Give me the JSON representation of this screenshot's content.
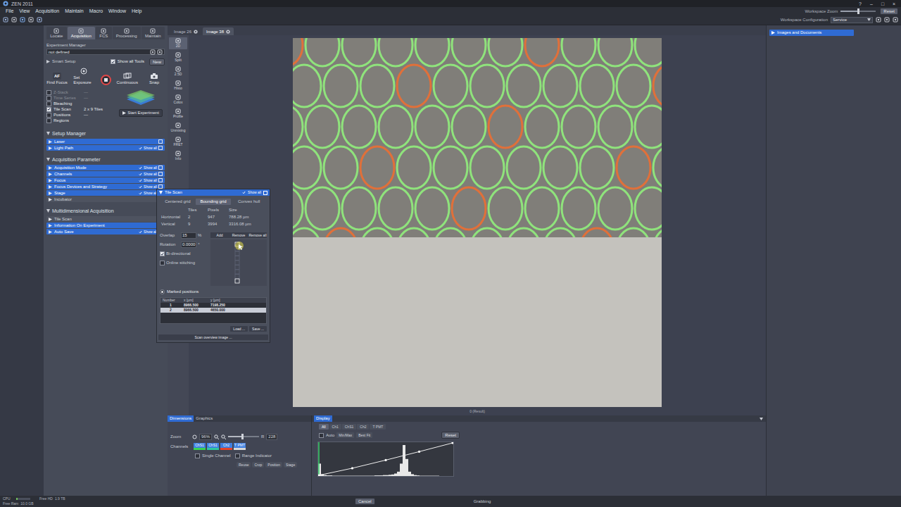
{
  "window": {
    "title": "ZEN 2011",
    "controls": [
      "?",
      "–",
      "□",
      "×"
    ]
  },
  "menu": [
    "File",
    "View",
    "Acquisition",
    "Maintain",
    "Macro",
    "Window",
    "Help"
  ],
  "workspace_zoom": {
    "label": "Workspace Zoom",
    "level": 0.5,
    "button": "Reset"
  },
  "workspace_configuration": {
    "label": "Workspace Configuration",
    "value": "Service"
  },
  "left_tabs": [
    {
      "label": "Locate",
      "selected": false
    },
    {
      "label": "Acquisition",
      "selected": true
    },
    {
      "label": "FCS",
      "selected": false
    },
    {
      "label": "Processing",
      "selected": false
    },
    {
      "label": "Maintain",
      "selected": false
    }
  ],
  "experiment_manager": {
    "title": "Experiment Manager",
    "value": "not defined"
  },
  "smart_setup": {
    "label": "Smart Setup",
    "show_all_tools": {
      "label": "Show all Tools",
      "checked": true
    },
    "new_button": "New"
  },
  "af_icon": "AF",
  "actions": [
    {
      "label": "Find Focus"
    },
    {
      "label": "Set Exposure"
    },
    {
      "label": "Continuous"
    },
    {
      "label": "Snap"
    }
  ],
  "live_button": {
    "active": true
  },
  "dimensions": [
    {
      "label": "Z-Stack",
      "checked": false,
      "disabled": true,
      "value": "—"
    },
    {
      "label": "Time Series",
      "checked": false,
      "disabled": true,
      "value": "—"
    },
    {
      "label": "Bleaching",
      "checked": false,
      "disabled": false
    },
    {
      "label": "Tile Scan",
      "checked": true,
      "disabled": false,
      "value": "2 x 9 Tiles"
    },
    {
      "label": "Positions",
      "checked": false,
      "disabled": false,
      "value": "—"
    },
    {
      "label": "Regions",
      "checked": false,
      "disabled": false
    }
  ],
  "start_experiment": "Start Experiment",
  "show_all_label": "Show all",
  "sections": [
    {
      "title": "Setup Manager",
      "items": [
        {
          "label": "Laser",
          "highlighted": true,
          "show_all": false
        },
        {
          "label": "Light Path",
          "highlighted": true,
          "show_all": true
        }
      ]
    },
    {
      "title": "Acquisition Parameter",
      "items": [
        {
          "label": "Acquisition Mode",
          "highlighted": true,
          "show_all": true
        },
        {
          "label": "Channels",
          "highlighted": true,
          "show_all": true
        },
        {
          "label": "Focus",
          "highlighted": true,
          "show_all": true
        },
        {
          "label": "Focus Devices and Strategy",
          "highlighted": true,
          "show_all": true
        },
        {
          "label": "Stage",
          "highlighted": true,
          "show_all": true
        },
        {
          "label": "Incubator",
          "highlighted": false,
          "show_all": false
        }
      ]
    },
    {
      "title": "Multidimensional Acquisition",
      "items": [
        {
          "label": "Tile Scan",
          "highlighted": false,
          "show_all": false
        },
        {
          "label": "Information On Experiment",
          "highlighted": true,
          "show_all": false
        },
        {
          "label": "Auto Save",
          "highlighted": true,
          "show_all": true
        }
      ]
    }
  ],
  "view_tabs": [
    {
      "label": "2D",
      "selected": true
    },
    {
      "label": "Split",
      "selected": false
    },
    {
      "label": "2.5D",
      "selected": false
    },
    {
      "label": "Histo",
      "selected": false
    },
    {
      "label": "Colox",
      "selected": false
    },
    {
      "label": "Profile",
      "selected": false
    },
    {
      "label": "Unmixing",
      "selected": false
    },
    {
      "label": "FRET",
      "selected": false
    },
    {
      "label": "Info",
      "selected": false
    }
  ],
  "image_tabs": [
    {
      "label": "Image 26",
      "selected": false
    },
    {
      "label": "Image 38",
      "selected": true
    }
  ],
  "image": {
    "scan_level": 0.54,
    "result_label": "0 (Result)"
  },
  "right_panel": {
    "title": "Images and Documents"
  },
  "tile_scan": {
    "title": "Tile Scan",
    "tabs": [
      {
        "label": "Centered grid",
        "selected": false
      },
      {
        "label": "Bounding grid",
        "selected": true
      },
      {
        "label": "Convex hull",
        "selected": false
      }
    ],
    "grid_columns": [
      "Tiles",
      "Pixels",
      "Size"
    ],
    "grid_rows": [
      {
        "label": "Horizontal",
        "tiles": "2",
        "pixels": "947",
        "size": "788.28 µm"
      },
      {
        "label": "Vertical",
        "tiles": "9",
        "pixels": "3994",
        "size": "3316.08 µm"
      }
    ],
    "overlap": {
      "label": "Overlap",
      "value": "15",
      "unit": "%"
    },
    "rotation": {
      "label": "Rotation",
      "value": "0.0000",
      "unit": "°"
    },
    "buttons": [
      "Add",
      "Remove",
      "Remove all"
    ],
    "options": [
      {
        "label": "Bi-directional",
        "checked": true
      },
      {
        "label": "Online stitching",
        "checked": false
      }
    ],
    "marked_positions": {
      "label": "Marked positions",
      "selected": true,
      "columns": [
        "Number",
        "x [µm]",
        "y [µm]"
      ],
      "rows": [
        {
          "cells": [
            "1",
            "8966.500",
            "7198.250"
          ],
          "selected": false
        },
        {
          "cells": [
            "2",
            "8966.500",
            "4650.000"
          ],
          "selected": true
        }
      ]
    },
    "file_buttons": [
      "Load ...",
      "Save ..."
    ],
    "scan_overview": "Scan overview image ..."
  },
  "dimensions_panel": {
    "tabs": [
      {
        "label": "Dimensions",
        "selected": true
      },
      {
        "label": "Graphics",
        "selected": false
      }
    ],
    "zoom": {
      "label": "Zoom",
      "value": "96%"
    },
    "slider": {
      "label": "R",
      "level": 0.45,
      "value": "228"
    },
    "channels": {
      "label": "Channels",
      "items": [
        {
          "label": "ChS1",
          "color": "#39d353"
        },
        {
          "label": "ChS1",
          "color": "#2fc7a0"
        },
        {
          "label": "Ch2",
          "color": "#e5442b"
        },
        {
          "label": "T PMT",
          "color": "#d8d8d8"
        }
      ]
    },
    "options": [
      {
        "label": "Single Channel",
        "checked": false
      },
      {
        "label": "Range Indicator",
        "checked": false
      }
    ],
    "buttons": [
      {
        "label": "Reuse",
        "disabled": false
      },
      {
        "label": "Crop",
        "disabled": false
      },
      {
        "label": "Position",
        "disabled": false
      },
      {
        "label": "Stage",
        "disabled": false
      }
    ]
  },
  "display_panel": {
    "tab": "Display",
    "channel_tabs": [
      {
        "label": "All",
        "selected": true
      },
      {
        "label": "Ch1",
        "selected": false
      },
      {
        "label": "ChS1",
        "selected": false
      },
      {
        "label": "Ch2",
        "selected": false
      },
      {
        "label": "T PMT",
        "selected": false
      }
    ],
    "auto": {
      "label": "Auto",
      "checked": false
    },
    "buttons": [
      "Min/Max",
      "Best Fit"
    ],
    "reset": "Reset",
    "histogram": {
      "values": [
        40,
        6,
        3,
        2,
        2,
        1,
        1,
        1,
        1,
        1,
        1,
        1,
        1,
        1,
        1,
        1,
        1,
        1,
        1,
        1,
        2,
        2,
        2,
        3,
        3,
        4,
        5,
        8,
        14,
        40,
        100,
        55,
        14,
        6,
        3,
        2,
        1,
        1,
        1,
        1,
        1,
        1,
        1,
        0,
        0,
        0,
        0,
        0
      ]
    },
    "curve": [
      [
        0,
        0
      ],
      [
        0.25,
        0.22
      ],
      [
        0.5,
        0.47
      ],
      [
        0.75,
        0.73
      ],
      [
        1,
        1
      ]
    ]
  },
  "status_bar": {
    "cpu": {
      "label": "CPU",
      "level": 0.08
    },
    "free_hd": {
      "label": "Free HD",
      "value": "1.9 TB"
    },
    "free_ram": {
      "label": "Free Ram",
      "value": "10.0 GB"
    },
    "cancel": "Cancel",
    "status": "Grabbing"
  }
}
